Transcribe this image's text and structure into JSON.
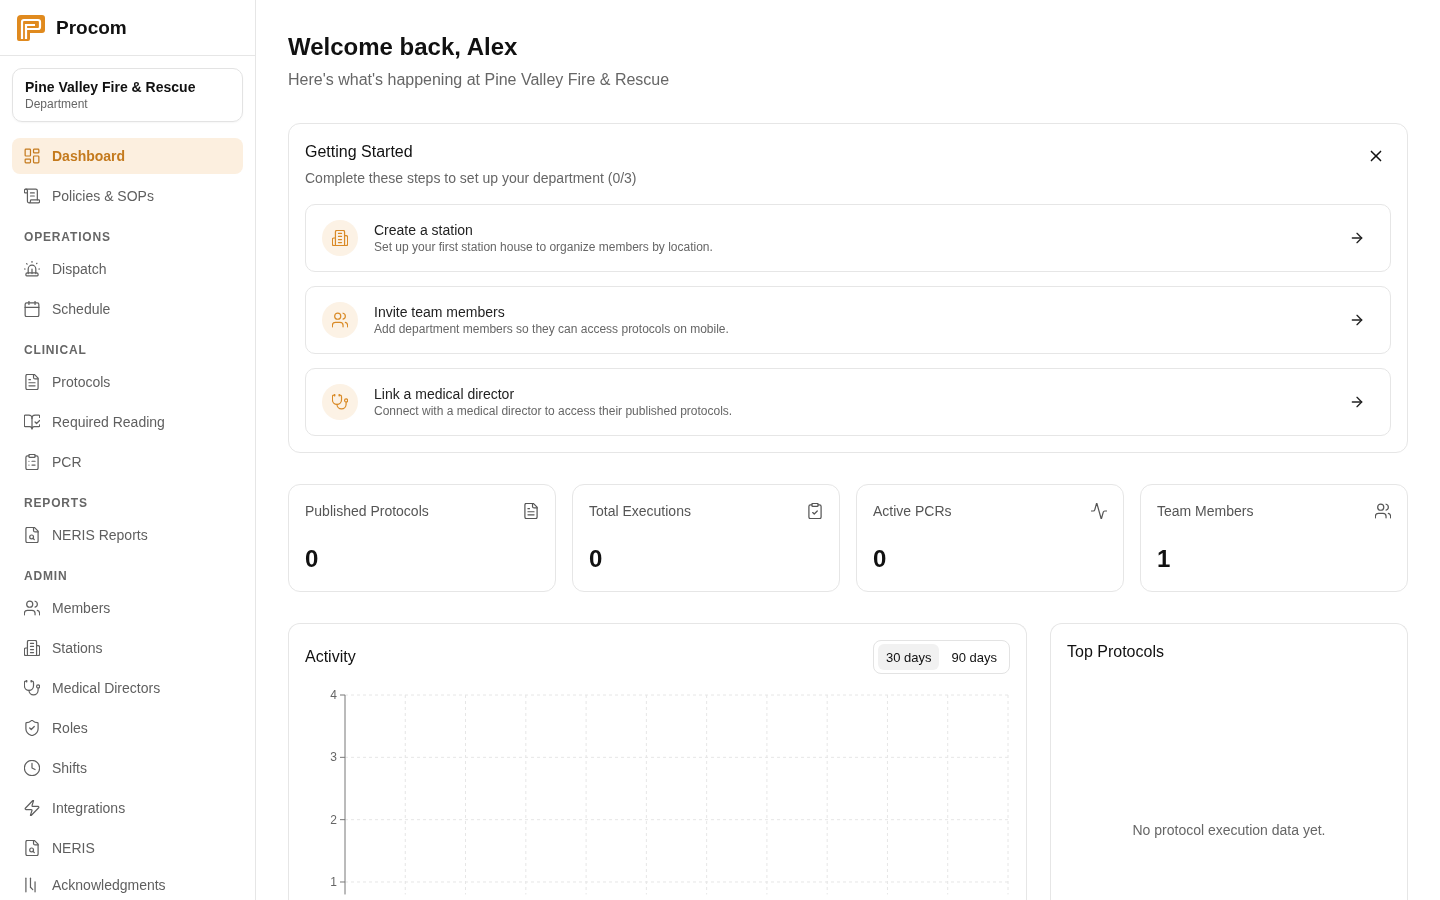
{
  "brand": {
    "name": "Procom"
  },
  "department": {
    "name": "Pine Valley Fire & Rescue",
    "type": "Department"
  },
  "sidebar": {
    "items": [
      {
        "label": "Dashboard",
        "selected": true
      },
      {
        "label": "Policies & SOPs",
        "selected": false
      }
    ],
    "sections": [
      {
        "title": "OPERATIONS",
        "items": [
          {
            "label": "Dispatch",
            "selected": false
          },
          {
            "label": "Schedule",
            "selected": false
          }
        ]
      },
      {
        "title": "CLINICAL",
        "items": [
          {
            "label": "Protocols",
            "selected": false
          },
          {
            "label": "Required Reading",
            "selected": false
          },
          {
            "label": "PCR",
            "selected": false
          }
        ]
      },
      {
        "title": "REPORTS",
        "items": [
          {
            "label": "NERIS Reports",
            "selected": false
          }
        ]
      },
      {
        "title": "ADMIN",
        "items": [
          {
            "label": "Members",
            "selected": false
          },
          {
            "label": "Stations",
            "selected": false
          },
          {
            "label": "Medical Directors",
            "selected": false
          },
          {
            "label": "Roles",
            "selected": false
          },
          {
            "label": "Shifts",
            "selected": false
          },
          {
            "label": "Integrations",
            "selected": false
          },
          {
            "label": "NERIS",
            "selected": false
          },
          {
            "label": "Acknowledgments",
            "selected": false
          }
        ]
      }
    ]
  },
  "header": {
    "title": "Welcome back, Alex",
    "subtitle": "Here's what's happening at Pine Valley Fire & Rescue"
  },
  "getting_started": {
    "title": "Getting Started",
    "subtitle": "Complete these steps to set up your department (0/3)",
    "steps": [
      {
        "title": "Create a station",
        "description": "Set up your first station house to organize members by location."
      },
      {
        "title": "Invite team members",
        "description": "Add department members so they can access protocols on mobile."
      },
      {
        "title": "Link a medical director",
        "description": "Connect with a medical director to access their published protocols."
      }
    ]
  },
  "stats": [
    {
      "label": "Published Protocols",
      "value": "0"
    },
    {
      "label": "Total Executions",
      "value": "0"
    },
    {
      "label": "Active PCRs",
      "value": "0"
    },
    {
      "label": "Team Members",
      "value": "1"
    }
  ],
  "activity": {
    "title": "Activity",
    "ranges": [
      {
        "label": "30 days",
        "selected": true
      },
      {
        "label": "90 days",
        "selected": false
      }
    ],
    "chart_data": {
      "type": "line",
      "categories": [
        null,
        null,
        null,
        null,
        null,
        null,
        null,
        null,
        null,
        null,
        null
      ],
      "ylim": [
        0.8,
        4
      ],
      "yticks": [
        1,
        2,
        3,
        4
      ],
      "grid": true
    }
  },
  "top_protocols": {
    "title": "Top Protocols",
    "empty_message": "No protocol execution data yet."
  }
}
